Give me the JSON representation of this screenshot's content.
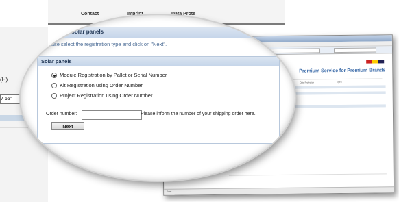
{
  "top_nav": {
    "contact": "Contact",
    "imprint": "Imprint",
    "data_protection": "Data Prote"
  },
  "left_fragments": {
    "frag1": "(H)",
    "frag2": "7 65\""
  },
  "browser": {
    "brand": "Premium Service for Premium Brands",
    "status_left": "Done",
    "nav_items": [
      "Data Protection",
      "GTC"
    ]
  },
  "registration": {
    "title": "Registration: Solar panels",
    "instruction": "Please select the registration type and click on \"Next\".",
    "panel_title": "Solar panels",
    "options": [
      {
        "label": "Module Registration by Pallet or Serial Number",
        "selected": true
      },
      {
        "label": "Kit Registration using Order Number",
        "selected": false
      },
      {
        "label": "Project Registration using Order Number",
        "selected": false
      }
    ],
    "order_label": "Order number:",
    "order_value": "",
    "order_hint": "Please inform the number of your shipping order here.",
    "next_label": "Next"
  }
}
